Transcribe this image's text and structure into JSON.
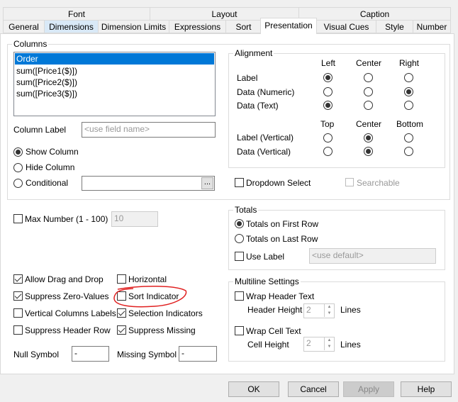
{
  "tabs_row1": [
    "Font",
    "Layout",
    "Caption"
  ],
  "tabs_row2": [
    "General",
    "Dimensions",
    "Dimension Limits",
    "Expressions",
    "Sort",
    "Presentation",
    "Visual Cues",
    "Style",
    "Number"
  ],
  "active_tab": "Presentation",
  "columns": {
    "title": "Columns",
    "items": [
      "Order",
      "sum([Price1($)])",
      "sum([Price2($)])",
      "sum([Price3($)])"
    ],
    "selected": "Order",
    "column_label": "Column Label",
    "column_label_placeholder": "<use field name>",
    "show_column": "Show Column",
    "hide_column": "Hide Column",
    "conditional": "Conditional",
    "ellipsis": "...",
    "visibility": "Show Column"
  },
  "alignment": {
    "title": "Alignment",
    "h_headers": [
      "Left",
      "Center",
      "Right"
    ],
    "rows": [
      {
        "label": "Label",
        "value": "Left"
      },
      {
        "label": "Data (Numeric)",
        "value": "Right"
      },
      {
        "label": "Data (Text)",
        "value": "Left"
      }
    ],
    "v_headers": [
      "Top",
      "Center",
      "Bottom"
    ],
    "vrows": [
      {
        "label": "Label (Vertical)",
        "value": "Center"
      },
      {
        "label": "Data (Vertical)",
        "value": "Center"
      }
    ]
  },
  "dropdown_select": {
    "label": "Dropdown Select",
    "checked": false
  },
  "searchable": {
    "label": "Searchable",
    "checked": false,
    "disabled": true
  },
  "max_number": {
    "label": "Max Number (1 - 100)",
    "checked": false,
    "value": "10"
  },
  "totals": {
    "title": "Totals",
    "first": "Totals on First Row",
    "last": "Totals on Last Row",
    "selected": "Totals on First Row",
    "use_label": "Use Label",
    "use_label_placeholder": "<use default>"
  },
  "options": [
    {
      "label": "Allow Drag and Drop",
      "checked": true
    },
    {
      "label": "Horizontal",
      "checked": false
    },
    {
      "label": "Suppress Zero-Values",
      "checked": true
    },
    {
      "label": "Sort Indicator",
      "checked": false
    },
    {
      "label": "Vertical Columns Labels",
      "checked": false
    },
    {
      "label": "Selection Indicators",
      "checked": true
    },
    {
      "label": "Suppress Header Row",
      "checked": false
    },
    {
      "label": "Suppress Missing",
      "checked": true
    }
  ],
  "null_symbol": {
    "label": "Null Symbol",
    "value": "-"
  },
  "missing_symbol": {
    "label": "Missing Symbol",
    "value": "-"
  },
  "multiline": {
    "title": "Multiline Settings",
    "wrap_header": "Wrap Header Text",
    "header_height": "Header Height",
    "header_value": "2",
    "wrap_cell": "Wrap Cell Text",
    "cell_height": "Cell Height",
    "cell_value": "2",
    "lines": "Lines"
  },
  "buttons": {
    "ok": "OK",
    "cancel": "Cancel",
    "apply": "Apply",
    "help": "Help"
  },
  "annotation_color": "#e02020"
}
